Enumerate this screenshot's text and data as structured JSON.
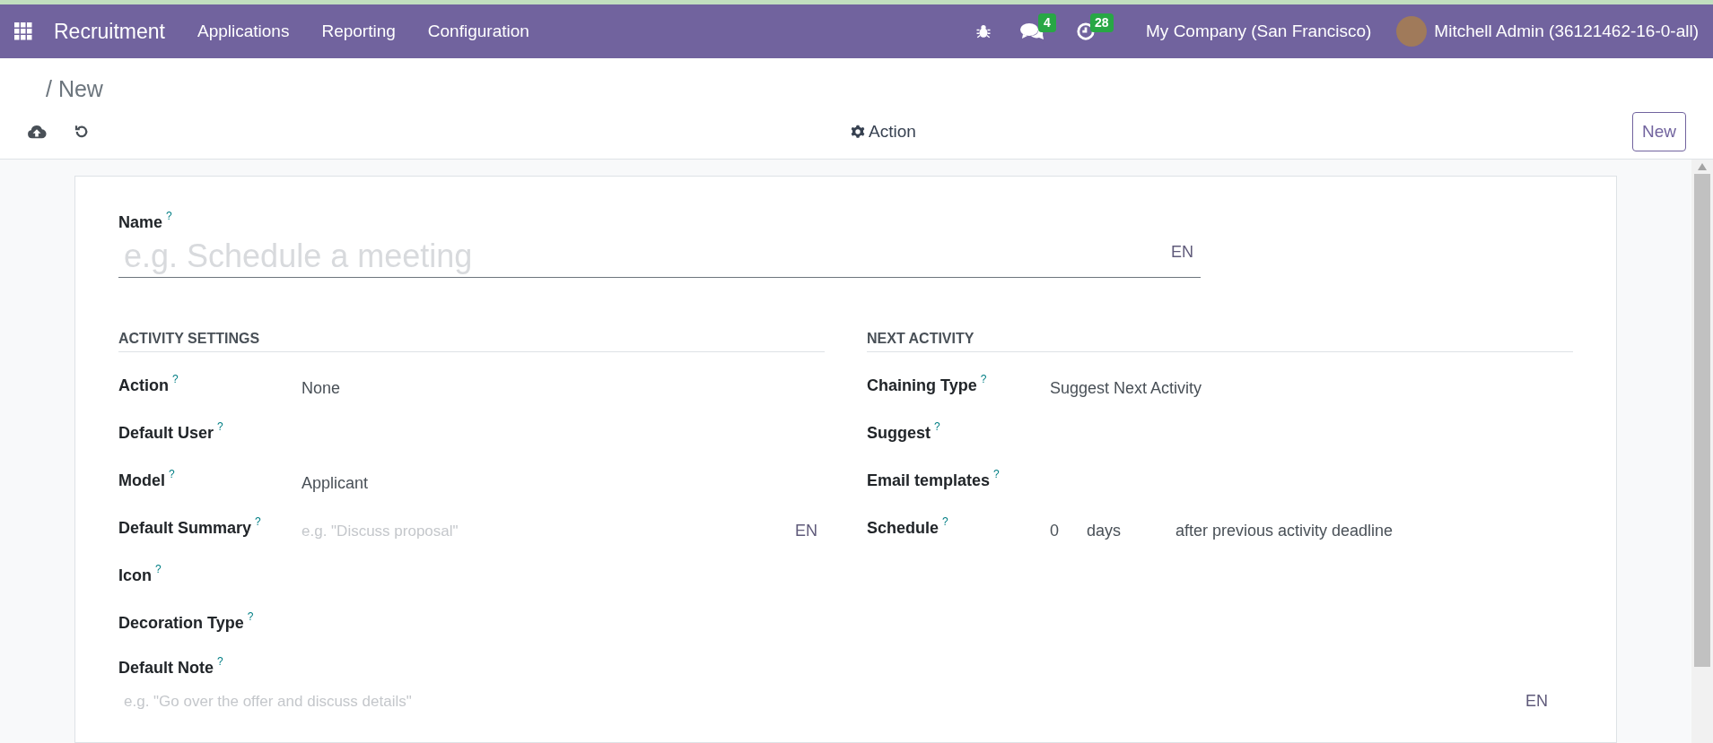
{
  "navbar": {
    "app_name": "Recruitment",
    "menu": [
      "Applications",
      "Reporting",
      "Configuration"
    ],
    "messages_badge": "4",
    "activities_badge": "28",
    "company": "My Company (San Francisco)",
    "user": "Mitchell Admin (36121462-16-0-all)"
  },
  "breadcrumb": "/ New",
  "control_panel": {
    "action_button": "Action",
    "new_button": "New"
  },
  "form": {
    "name": {
      "label": "Name",
      "help": "?",
      "placeholder": "e.g. Schedule a meeting",
      "lang": "EN"
    },
    "sections": [
      {
        "title": "ACTIVITY SETTINGS",
        "fields": [
          {
            "kind": "text",
            "label": "Action",
            "help": "?",
            "value": "None"
          },
          {
            "kind": "empty",
            "label": "Default User",
            "help": "?"
          },
          {
            "kind": "text",
            "label": "Model",
            "help": "?",
            "value": "Applicant"
          },
          {
            "kind": "placeholder",
            "label": "Default Summary",
            "help": "?",
            "placeholder": "e.g. \"Discuss proposal\"",
            "lang": "EN"
          },
          {
            "kind": "empty",
            "label": "Icon",
            "help": "?"
          },
          {
            "kind": "empty",
            "label": "Decoration Type",
            "help": "?"
          }
        ]
      },
      {
        "title": "NEXT ACTIVITY",
        "fields": [
          {
            "kind": "text",
            "label": "Chaining Type",
            "help": "?",
            "value": "Suggest Next Activity"
          },
          {
            "kind": "empty",
            "label": "Suggest",
            "help": "?"
          },
          {
            "kind": "empty",
            "label": "Email templates",
            "help": "?"
          },
          {
            "kind": "schedule",
            "label": "Schedule",
            "help": "?",
            "values": [
              "0",
              "days",
              "after previous activity deadline"
            ]
          }
        ]
      }
    ],
    "note": {
      "label": "Default Note",
      "help": "?",
      "placeholder": "e.g. \"Go over the offer and discuss details\"",
      "lang": "EN"
    }
  }
}
